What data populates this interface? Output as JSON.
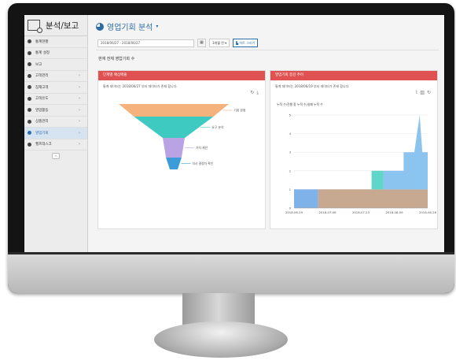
{
  "app": {
    "title": "분석/보고",
    "page_title": "영업기회 분석"
  },
  "sidebar": {
    "items": [
      {
        "label": "통계현황",
        "icon": "pie-chart-icon",
        "chevron": false
      },
      {
        "label": "통계 설정",
        "icon": "pie-chart-icon",
        "chevron": false
      },
      {
        "label": "보고",
        "icon": "pie-chart-icon",
        "chevron": false
      },
      {
        "label": "고객관리",
        "icon": "handshake-icon",
        "chevron": true
      },
      {
        "label": "잠재고객",
        "icon": "info-icon",
        "chevron": true
      },
      {
        "label": "고객유도",
        "icon": "building-icon",
        "chevron": true
      },
      {
        "label": "영업활동",
        "icon": "briefcase-icon",
        "chevron": true
      },
      {
        "label": "상품관리",
        "icon": "gift-icon",
        "chevron": true
      },
      {
        "label": "영업기회",
        "icon": "chart-icon",
        "chevron": true,
        "active": true
      },
      {
        "label": "헬프데스크",
        "icon": "headset-icon",
        "chevron": true
      }
    ],
    "collapse": "«"
  },
  "toolbar": {
    "date_range": "2018/06/27 - 2018/06/27",
    "period": "3개월 전",
    "draw_label": "차트 그리기"
  },
  "subtitle": "현재 전체 영업기회 수",
  "left_panel": {
    "header": "단계별 예상매출",
    "note": "통계 데이터는 2018/06/27 부터 데이터가 존재 합니다.",
    "chart_data": {
      "type": "funnel",
      "stages": [
        {
          "label": "기회 판정",
          "value": 100,
          "color": "#f6b27d"
        },
        {
          "label": "요구 분석",
          "value": 52,
          "color": "#3ec9c1"
        },
        {
          "label": "가치 제안",
          "value": 4,
          "color": "#b9a3e3"
        },
        {
          "label": "의사 결정자 확인",
          "value": 2,
          "color": "#3c9bd9"
        }
      ]
    }
  },
  "right_panel": {
    "header": "영업기회 증감 추이",
    "note": "통계 데이터는 2018/06/19 부터 데이터가 존재 합니다.",
    "legend": "누적 수/진행 중 누적 수/실패 누적 수",
    "chart_data": {
      "type": "area",
      "x_ticks": [
        "2018-06-19",
        "2018-07-06",
        "2018-07-23",
        "2018-08-09",
        "2018-08-26"
      ],
      "y_ticks": [
        "0",
        "1",
        "2",
        "3",
        "4",
        "5"
      ],
      "ylim": [
        0,
        5
      ]
    }
  }
}
